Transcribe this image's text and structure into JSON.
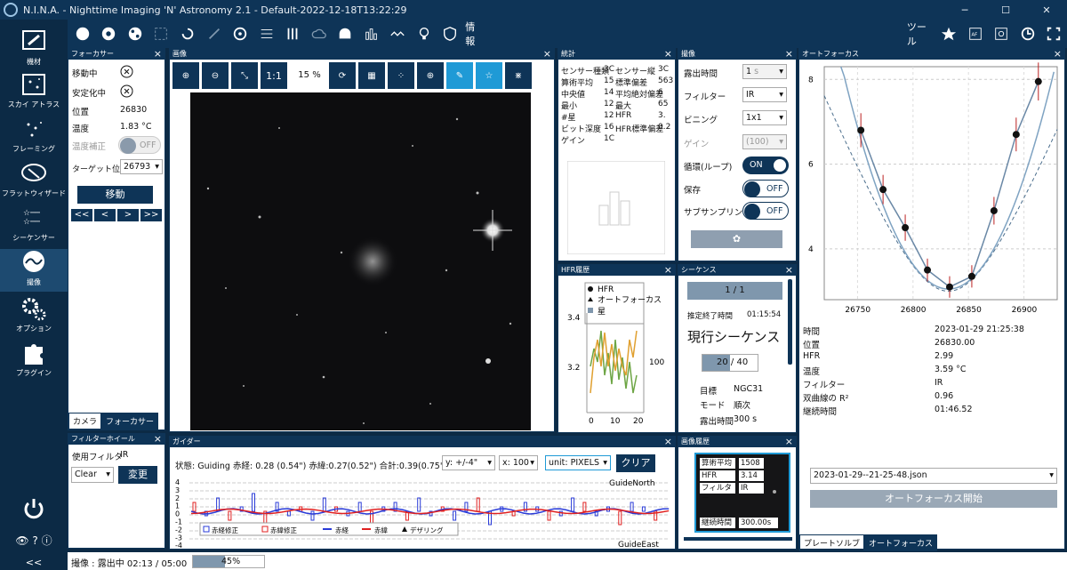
{
  "window": {
    "title": "N.I.N.A. - Nighttime Imaging 'N' Astronomy 2.1   -  Default-2022-12-18T13:22:29"
  },
  "sidebar": {
    "items": [
      "機材",
      "スカイ アトラス",
      "フレーミング",
      "フラットウィザード",
      "シーケンサー",
      "撮像",
      "オプション",
      "プラグイン"
    ],
    "collapse": "<<"
  },
  "toolbar": {
    "info_label": "情報",
    "tools_label": "ツール"
  },
  "focuser": {
    "title": "フォーカサー",
    "moving_label": "移動中",
    "settled_label": "安定化中",
    "position_label": "位置",
    "position": "26830",
    "temp_label": "温度",
    "temp": "1.83 °C",
    "tempcomp_label": "温度補正",
    "tempcomp": "OFF",
    "target_label": "ターゲット位置",
    "target": "26793",
    "move_label": "移動",
    "steps": [
      "<<",
      "<",
      ">",
      ">>"
    ],
    "tabs": [
      "カメラ",
      "フォーカサー"
    ]
  },
  "filterwheel": {
    "title": "フィルターホイール",
    "used_label": "使用フィルタ",
    "used": "IR",
    "select": "Clear",
    "change_label": "変更"
  },
  "image": {
    "title": "画像",
    "fit_label": "1:1",
    "zoom": "15 %"
  },
  "stats": {
    "title": "統計",
    "rows": [
      [
        "センサー種類",
        "3C",
        "センサー縦",
        "3C"
      ],
      [
        "算術平均",
        "15",
        "標準偏差",
        "563"
      ],
      [
        "中央値",
        "14",
        "平均絶対偏差",
        "6"
      ],
      [
        "最小",
        "12",
        "最大",
        "65"
      ],
      [
        "#星",
        "12",
        "HFR",
        "3."
      ],
      [
        "ビット深度",
        "16",
        "HFR標準偏差",
        "0.2"
      ],
      [
        "ゲイン",
        "1C",
        "",
        ""
      ]
    ]
  },
  "capture": {
    "title": "撮像",
    "exposure_label": "露出時間",
    "exposure": "1",
    "exposure_unit": "s",
    "filter_label": "フィルター",
    "filter": "IR",
    "binning_label": "ビニング",
    "binning": "1x1",
    "gain_label": "ゲイン",
    "gain": "(100)",
    "loop_label": "循環(ループ)",
    "loop": "ON",
    "save_label": "保存",
    "save": "OFF",
    "subsample_label": "サブサンプリング",
    "subsample": "OFF"
  },
  "hfr": {
    "title": "HFR履歴",
    "legend": [
      "HFR",
      "オートフォーカス",
      "星"
    ],
    "ylabels": [
      "3.4",
      "3.2"
    ],
    "y2label": "100",
    "xlabels": [
      "0",
      "10",
      "20"
    ]
  },
  "sequence": {
    "title": "シーケンス",
    "progress": "1 / 1",
    "eta_label": "推定終了時間",
    "eta": "01:15:54",
    "current_label": "現行シーケンス",
    "count": "20 / 40",
    "target_label": "目標",
    "target": "NGC31",
    "mode_label": "モード",
    "mode": "順次",
    "exp_label": "露出時間",
    "exp": "300 s"
  },
  "autofocus": {
    "title": "オートフォーカス",
    "xlabels": [
      "26750",
      "26800",
      "26850",
      "26900"
    ],
    "ylabels": [
      "8",
      "6",
      "4"
    ],
    "info": [
      [
        "時間",
        "2023-01-29 21:25:38"
      ],
      [
        "位置",
        "26830.00"
      ],
      [
        "HFR",
        "2.99"
      ],
      [
        "温度",
        "3.59 °C"
      ],
      [
        "フィルター",
        "IR"
      ],
      [
        "双曲線の R²",
        "0.96"
      ],
      [
        "継続時間",
        "01:46.52"
      ]
    ],
    "file": "2023-01-29--21-25-48.json",
    "start_label": "オートフォーカス開始",
    "tabs": [
      "プレートソルブ",
      "オートフォーカス"
    ],
    "chart_data": {
      "type": "line",
      "x": [
        26753,
        26773,
        26793,
        26813,
        26833,
        26853,
        26873,
        26893,
        26913
      ],
      "y": [
        6.8,
        5.4,
        4.5,
        3.5,
        3.1,
        3.35,
        4.9,
        6.7,
        7.95
      ],
      "xlim": [
        26720,
        26930
      ],
      "ylim": [
        2.8,
        8.3
      ]
    }
  },
  "guider": {
    "title": "ガイダー",
    "status": "状態: Guiding  赤経: 0.28 (0.54\")  赤緯:0.27(0.52\")  合計:0.39(0.75\")",
    "ysel": "y: +/-4\"",
    "xsel": "x: 100",
    "unit": "unit: PIXELS",
    "clear_label": "クリア",
    "north": "GuideNorth",
    "east": "GuideEast",
    "yticks": [
      "4",
      "3",
      "2",
      "1",
      "0",
      "-1",
      "-2",
      "-3",
      "-4"
    ],
    "legend": [
      "赤経修正",
      "赤緯修正",
      "赤経",
      "赤緯",
      "デザリング"
    ]
  },
  "imghist": {
    "title": "画像履歴",
    "rows": [
      [
        "算術平均",
        "1508"
      ],
      [
        "HFR",
        "3.14"
      ],
      [
        "フィルター",
        "IR"
      ]
    ],
    "duration_label": "継続時間",
    "duration": "300.00s"
  },
  "status": {
    "text": "撮像 :  露出中 02:13 / 05:00",
    "progress": "45%",
    "progress_value": 0.45
  }
}
